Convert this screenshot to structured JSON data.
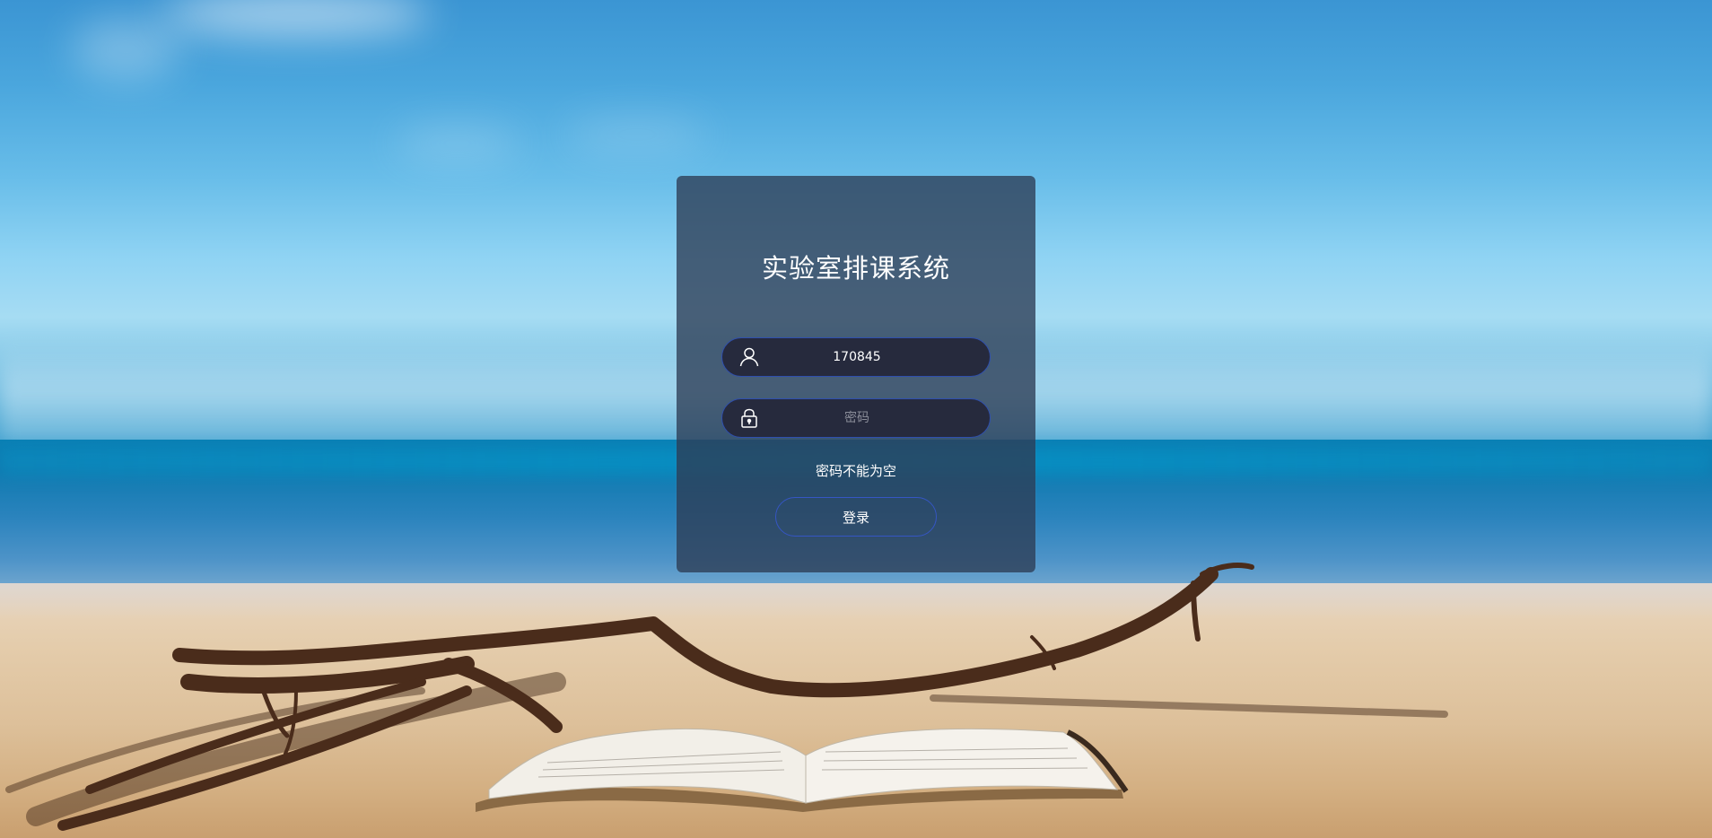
{
  "app": {
    "title": "实验室排课系统"
  },
  "form": {
    "username_value": "170845",
    "password_placeholder": "密码",
    "error_message": "密码不能为空",
    "login_label": "登录"
  },
  "icons": {
    "username": "user-icon",
    "password": "lock-icon"
  },
  "colors": {
    "panel_bg": "#2d3c55",
    "field_bg": "#262a3d",
    "field_border": "#2f4fae",
    "button_border": "#3556c4",
    "text": "#ffffff"
  }
}
